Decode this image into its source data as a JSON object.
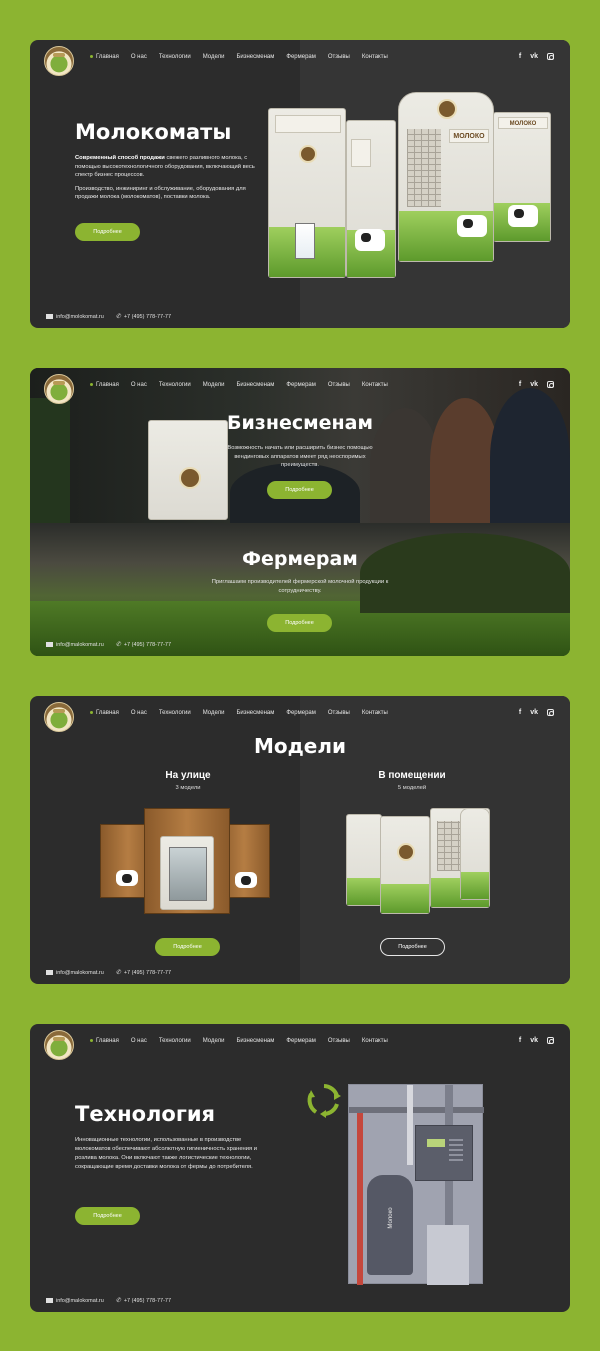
{
  "nav": {
    "items": [
      "Главная",
      "О нас",
      "Технологии",
      "Модели",
      "Бизнесменам",
      "Фермерам",
      "Отзывы",
      "Контакты"
    ],
    "social": [
      "f",
      "vk"
    ]
  },
  "accent_color": "#8cb431",
  "footer": {
    "email": "info@molokomat.ru",
    "email2": "info@malokomat.ru",
    "phone": "+7 (495) 778-77-77"
  },
  "panel1": {
    "title": "Молокоматы",
    "lead_bold": "Современный способ продажи",
    "lead_rest": " свежего разливного молока, с помощью высокотехнологичного оборудования, включающий весь спектр бизнес процессов.",
    "text2": "Производство, инжиниринг и обслуживание, оборудования для продажи молока (молокоматов), поставки молока.",
    "button": "Подробнее",
    "machine_label_milk": "МОЛОКО",
    "machine_label_milk2": "МОЛОКО"
  },
  "panel2": {
    "title_business": "Бизнесменам",
    "text_business": "Возможность начать или расширить бизнес помощью вендинговых аппаратов имеет ряд неоспоримых преимуществ.",
    "button_business": "Подробнее",
    "title_farmers": "Фермерам",
    "text_farmers": "Приглашаем производителей фермерской молочной продукции к сотрудничеству.",
    "button_farmers": "Подробнее"
  },
  "panel3": {
    "title": "Модели",
    "outdoor_title": "На улице",
    "outdoor_count": "3 модели",
    "indoor_title": "В помещении",
    "indoor_count": "5 моделей",
    "button_outdoor": "Подробнее",
    "button_indoor": "Подробнее"
  },
  "panel4": {
    "title": "Технология",
    "text": "Инновационные технологии, использованные в производстве молокоматов обеспечивают абсолютную гигиеничность хранения и розлива молока. Они включают также логистические технологии, сокращающие время доставки молока от фермы до потребителя.",
    "button": "Подробнее",
    "tank_label": "Молоко"
  }
}
